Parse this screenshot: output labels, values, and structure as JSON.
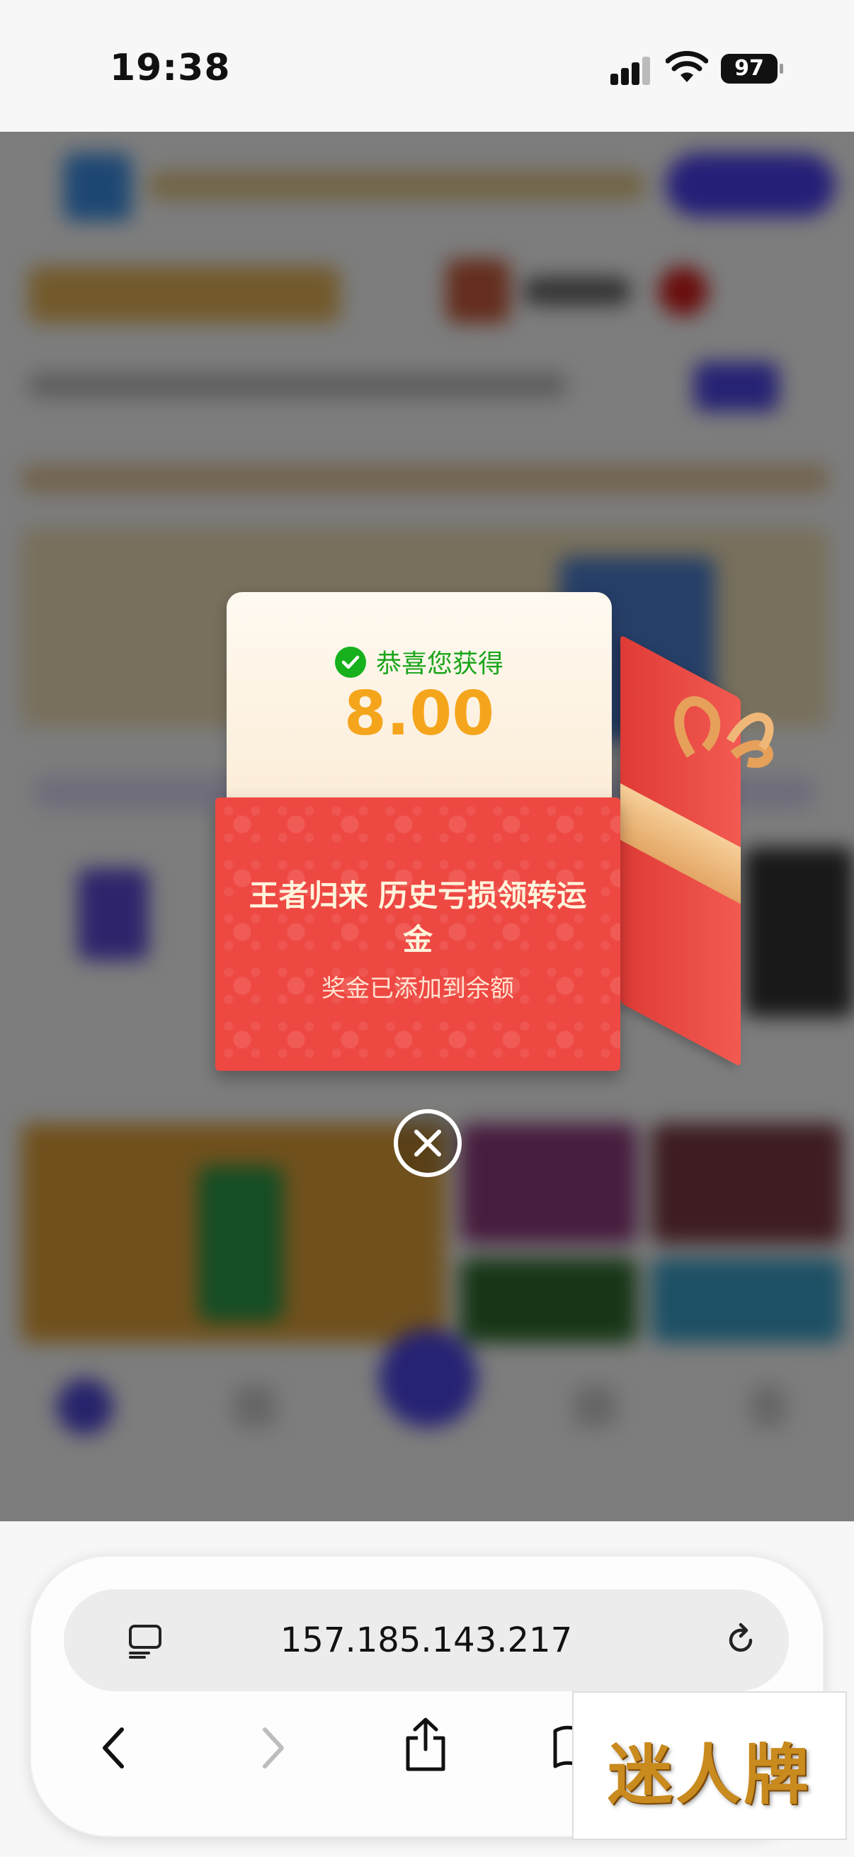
{
  "status_bar": {
    "time": "19:38",
    "battery": "97"
  },
  "reward_modal": {
    "congrats_text": "恭喜您获得",
    "amount": "8.00",
    "title": "王者归来 历史亏损领转运金",
    "subtitle": "奖金已添加到余额",
    "icons": [
      "check-icon",
      "close-icon"
    ]
  },
  "browser": {
    "url": "157.185.143.217",
    "icons": [
      "reader-icon",
      "reload-icon",
      "back-icon",
      "forward-icon",
      "share-icon",
      "bookmarks-icon"
    ]
  },
  "watermark": {
    "text": "迷人牌"
  },
  "colors": {
    "box_red": "#ee4843",
    "amount_orange": "#f5a51c",
    "congrats_green": "#1aa51a",
    "ribbon_gold": "#e4a665"
  }
}
